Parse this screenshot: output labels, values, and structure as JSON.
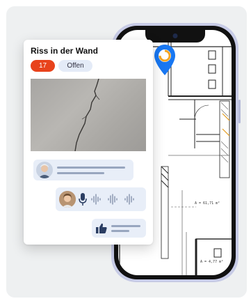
{
  "card": {
    "title": "Riss in der Wand",
    "number": "17",
    "status": "Offen"
  },
  "floorplan": {
    "area_1": "A = 61,71 m²",
    "area_2": "A = 4,77 m²"
  },
  "colors": {
    "accent_orange": "#e8431c",
    "pin_blue": "#1877f2",
    "phone_frame": "#c7cbe6",
    "bubble_bg": "#e8eef8",
    "status_bg": "#e4ebf7"
  },
  "icons": {
    "pin": "location-pin-icon",
    "mic": "microphone-icon",
    "thumb": "thumbs-up-icon"
  }
}
